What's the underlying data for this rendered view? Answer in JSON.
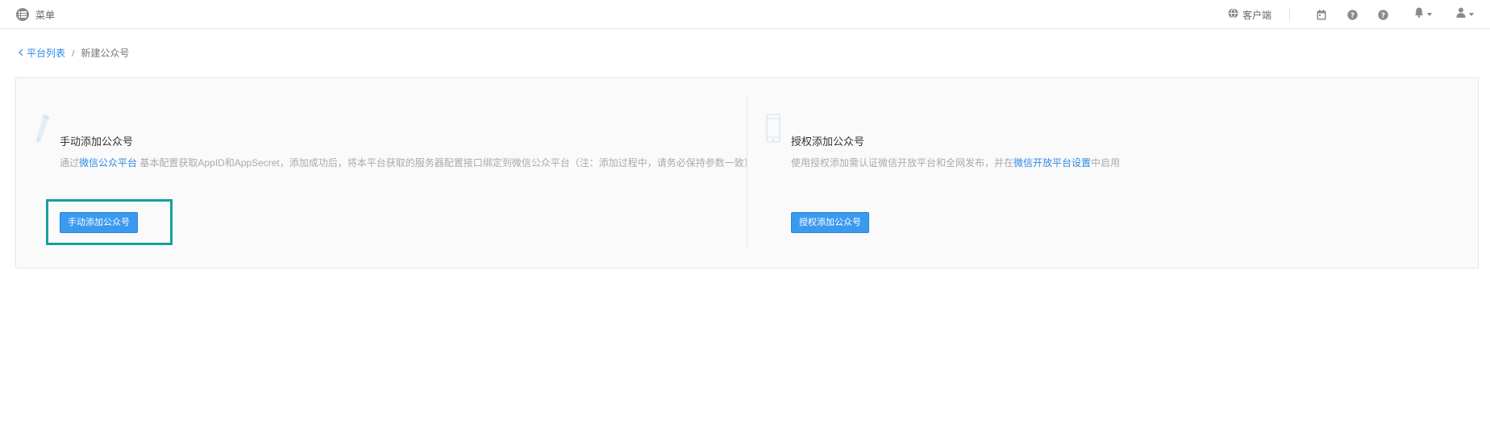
{
  "topbar": {
    "menu_label": "菜单",
    "menu_icon": "list-icon",
    "client_label": "客户端",
    "client_icon": "globe-icon",
    "icons": [
      "calendar-icon",
      "help-icon",
      "help-icon",
      "bell-icon",
      "user-icon"
    ]
  },
  "breadcrumb": {
    "back_label": "平台列表",
    "separator": "/",
    "current": "新建公众号"
  },
  "manual": {
    "icon": "pencil-icon",
    "title": "手动添加公众号",
    "desc_prefix": "通过",
    "desc_link": "微信公众平台",
    "desc_suffix": " 基本配置获取AppID和AppSecret，添加成功后，将本平台获取的服务器配置接口绑定到微信公众平台（注：添加过程中，请务必保持参数一致）",
    "button_label": "手动添加公众号"
  },
  "auth": {
    "icon": "phone-icon",
    "title": "授权添加公众号",
    "desc_prefix": "使用授权添加需认证微信开放平台和全网发布，并在",
    "desc_link": "微信开放平台设置",
    "desc_suffix": "中启用",
    "button_label": "授权添加公众号"
  },
  "colors": {
    "accent": "#3a9af0",
    "link": "#2f88e6",
    "highlight": "#16a09c"
  }
}
